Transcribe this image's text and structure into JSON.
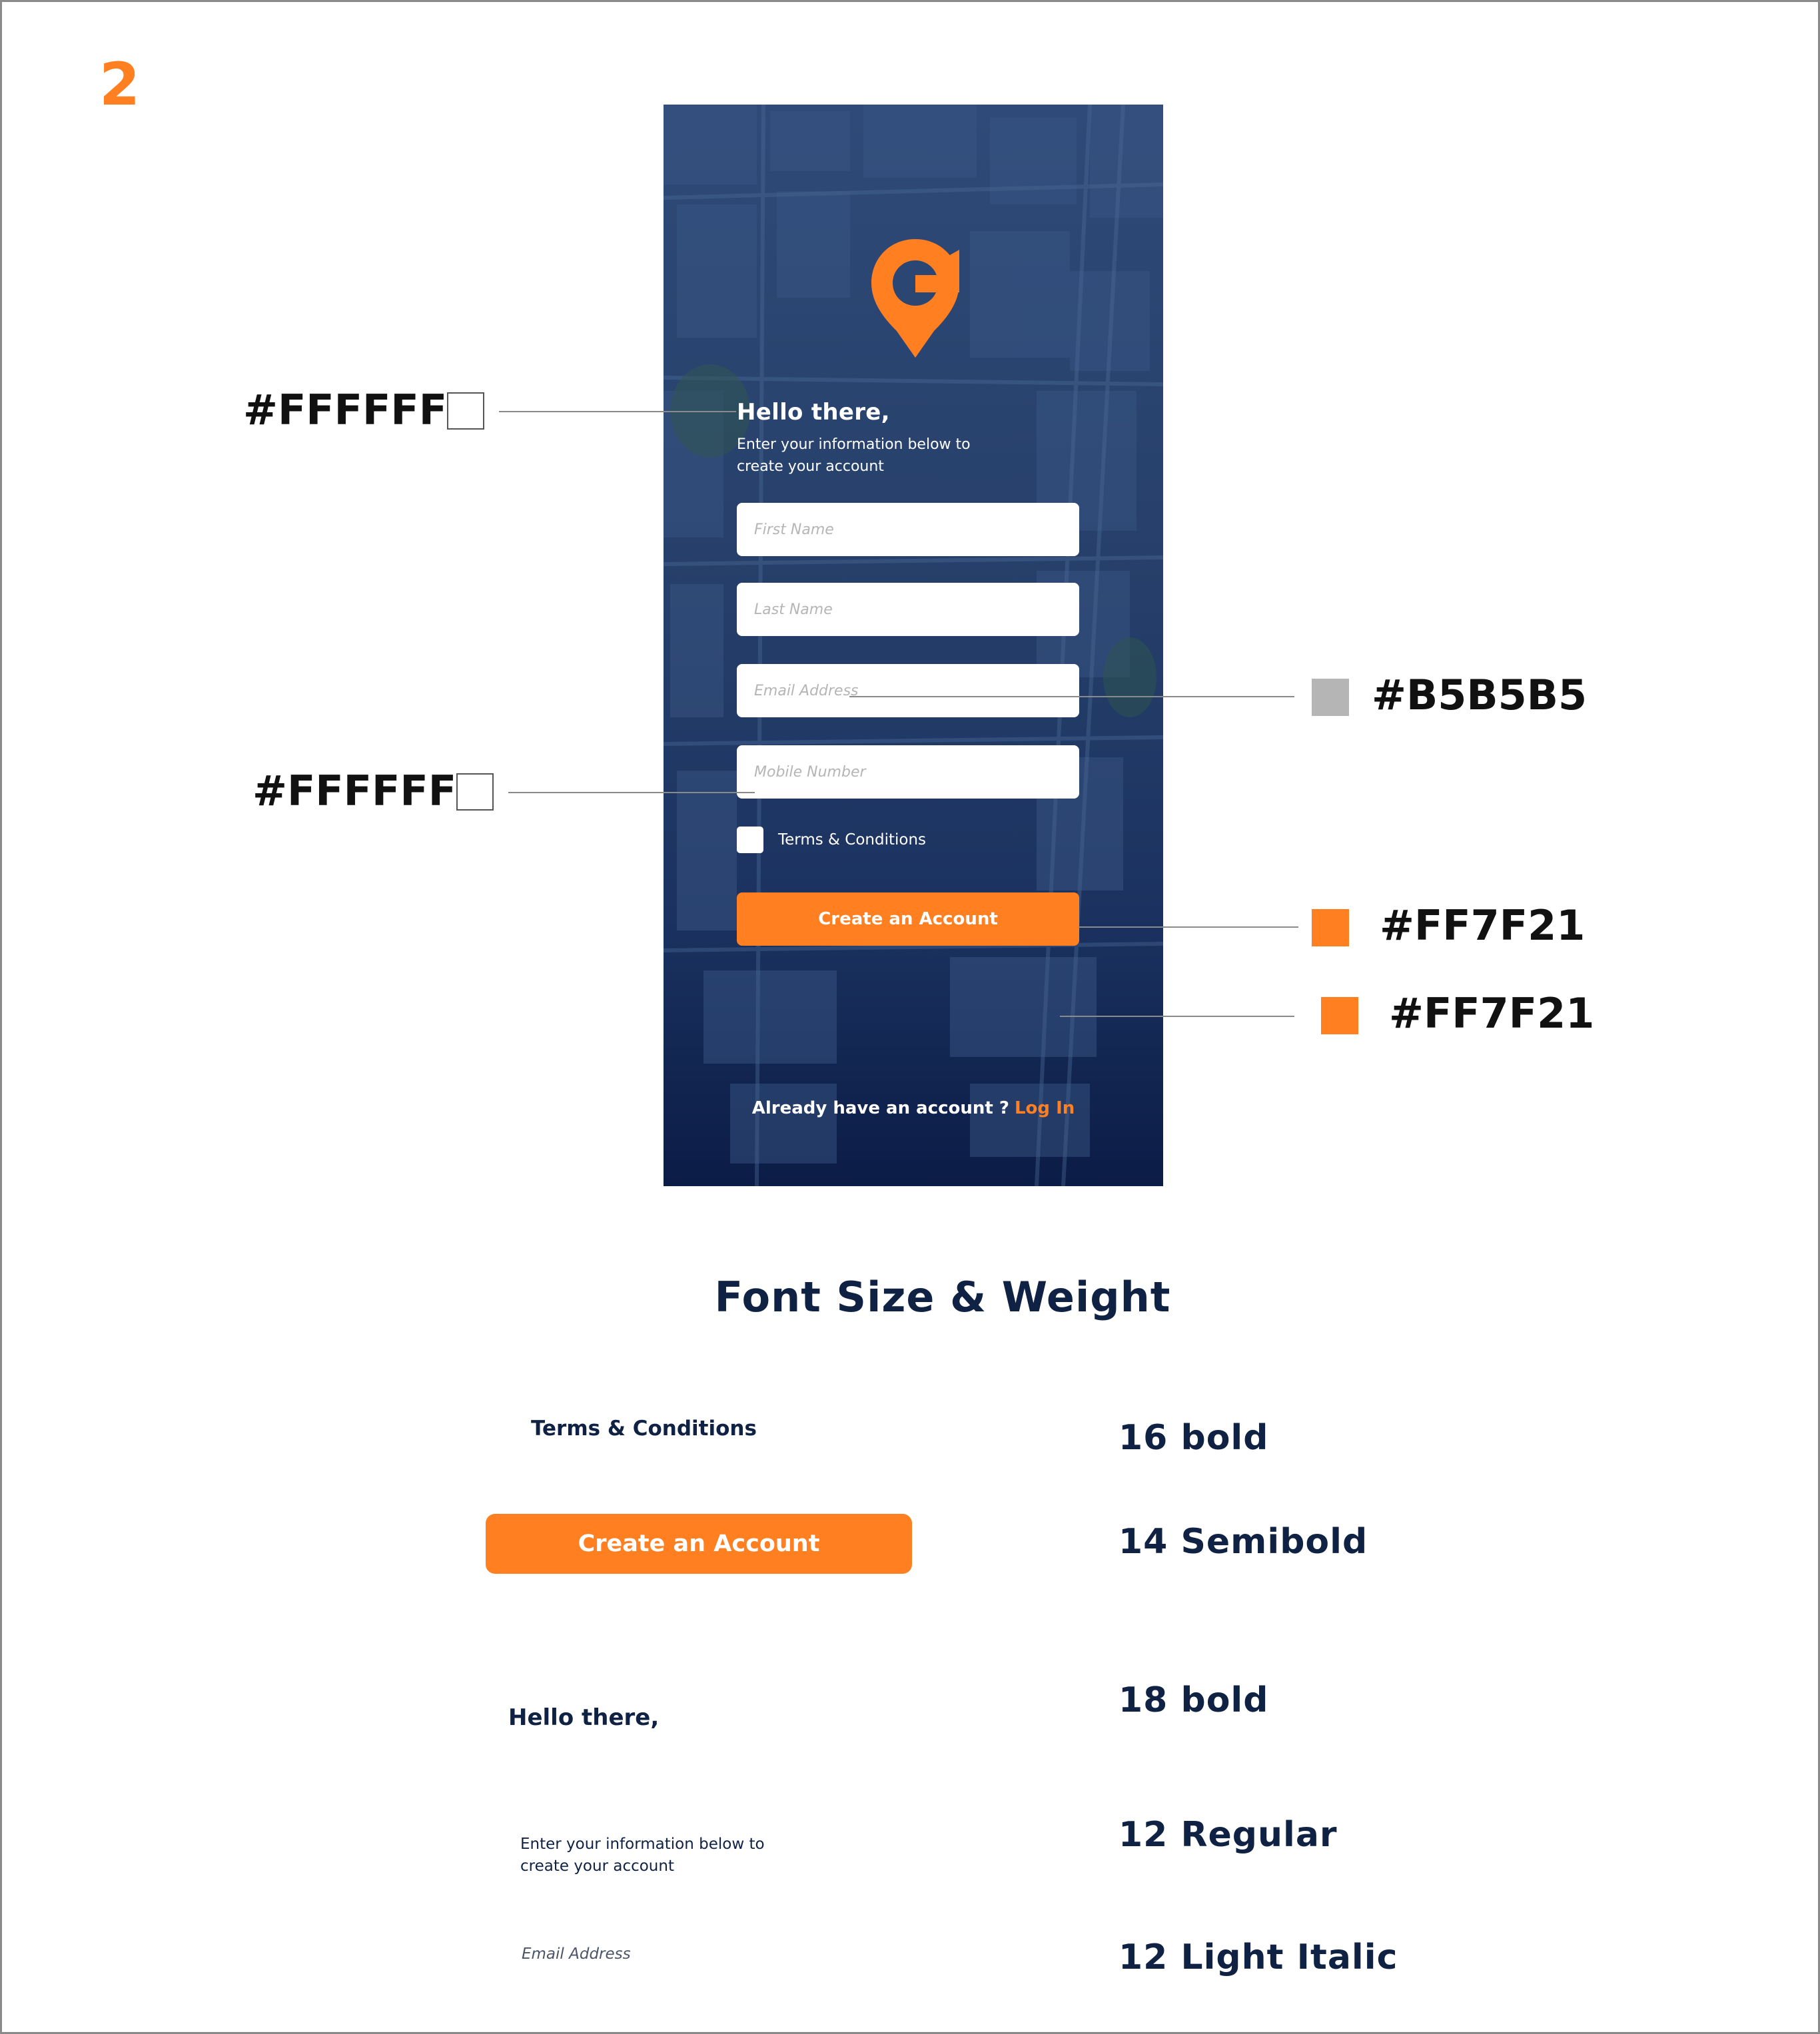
{
  "page_number": "2",
  "phone": {
    "greeting": "Hello there,",
    "subtitle": "Enter your information below to create your account",
    "fields": {
      "first_name_placeholder": "First Name",
      "last_name_placeholder": "Last Name",
      "email_placeholder": "Email Address",
      "mobile_placeholder": "Mobile Number"
    },
    "terms_label": "Terms & Conditions",
    "create_button": "Create an Account",
    "login_prompt": "Already have an account ?",
    "login_link": "Log In",
    "logo_icon": "location-pin-logo-icon"
  },
  "annotations": {
    "greeting_color": "#FFFFFF",
    "mobile_field_color": "#FFFFFF",
    "placeholder_color": "#B5B5B5",
    "button_color": "#FF7F21",
    "login_link_color": "#FF7F21"
  },
  "font_section": {
    "title": "Font Size & Weight",
    "items": [
      {
        "sample": "Terms & Conditions",
        "spec": "16 bold"
      },
      {
        "sample": "Create an Account",
        "spec": "14 Semibold"
      },
      {
        "sample": "Hello there,",
        "spec": "18 bold"
      },
      {
        "sample": "Enter your information below to create your account",
        "spec": "12 Regular"
      },
      {
        "sample": "Email Address",
        "spec": "12 Light Italic"
      }
    ]
  },
  "colors": {
    "accent": "#FF7F21",
    "placeholder": "#B5B5B5",
    "white": "#FFFFFF",
    "navy": "#0f2244"
  }
}
